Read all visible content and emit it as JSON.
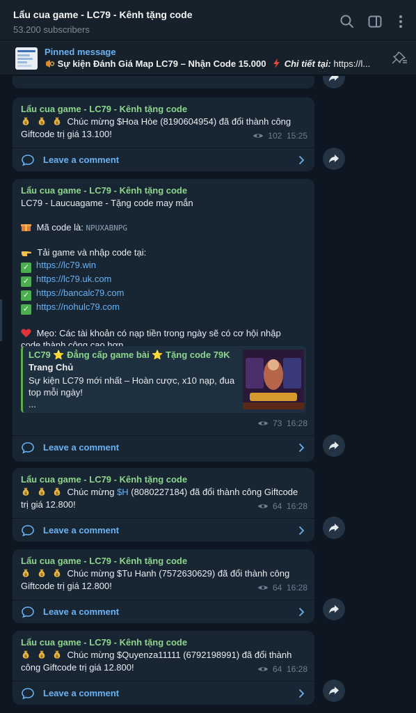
{
  "header": {
    "title": "Lẩu cua game - LC79 - Kênh tặng code",
    "subscribers": "53.200 subscribers"
  },
  "pinned": {
    "label": "Pinned message",
    "text_main": "Sự kiện Đánh Giá Map LC79 – Nhận Code 15.000",
    "text_detail": "Chi tiết tại:",
    "text_link": "https://l..."
  },
  "comment_label": "Leave a comment",
  "posts": [
    {
      "author": "Lẩu cua game - LC79 - Kênh tặng code",
      "line1": "Chúc mừng $Hoa Hòe (8190604954) đã đổi thành công",
      "line2": "Giftcode trị giá 13.100!",
      "views": "102",
      "time": "15:25"
    },
    {
      "author": "Lẩu cua game - LC79 - Kênh tặng code",
      "intro": "LC79 - Laucuagame - Tặng code may mắn",
      "code_label": "Mã code là:",
      "code": "NPUXABNPG",
      "download_label": "Tải game và nhập code tại:",
      "links": [
        "https://lc79.win",
        "https://lc79.uk.com",
        "https://bancalc79.com",
        "https://nohulc79.com"
      ],
      "tip_line1": "Mẹo: Các tài khoản có nạp tiền trong ngày sẽ có cơ hội nhập",
      "tip_line2": "code thành công cao hơn",
      "preview": {
        "title": "LC79 ⭐ Đẳng cấp game bài ⭐ Tặng code 79K",
        "site": "Trang Chủ",
        "desc1": "Sự kiện LC79 mới nhất – Hoàn cược, x10 nạp, đua",
        "desc2": "top mỗi ngày!",
        "desc3": "..."
      },
      "views": "73",
      "time": "16:28"
    },
    {
      "author": "Lẩu cua game - LC79 - Kênh tặng code",
      "line1_pre": "Chúc mừng ",
      "line1_mention": "$H",
      "line1_post": " (8080227184) đã đổi thành công Giftcode",
      "line2": "trị giá 12.800!",
      "views": "64",
      "time": "16:28"
    },
    {
      "author": "Lẩu cua game - LC79 - Kênh tặng code",
      "line1": "Chúc mừng $Tu Hanh (7572630629) đã đổi thành công",
      "line2": "Giftcode trị giá 12.800!",
      "views": "64",
      "time": "16:28"
    },
    {
      "author": "Lẩu cua game - LC79 - Kênh tặng code",
      "line1": "Chúc mừng $Quyenza11111 (6792198991) đã đổi thành",
      "line2": "công Giftcode trị giá 12.800!",
      "views": "64",
      "time": "16:28"
    }
  ],
  "colors": {
    "background": "#0e1621",
    "bubble": "#182533",
    "author": "#8dd58c",
    "link": "#6ab2f2",
    "header": "#17212b"
  },
  "icons": [
    "search-icon",
    "sidebar-toggle-icon",
    "more-vertical-icon",
    "unpin-icon",
    "comment-icon",
    "chevron-right-icon",
    "share-icon",
    "eye-icon",
    "money-bag-icon",
    "gift-icon",
    "pointing-hand-icon",
    "check-icon",
    "heart-icon",
    "star-icon"
  ]
}
